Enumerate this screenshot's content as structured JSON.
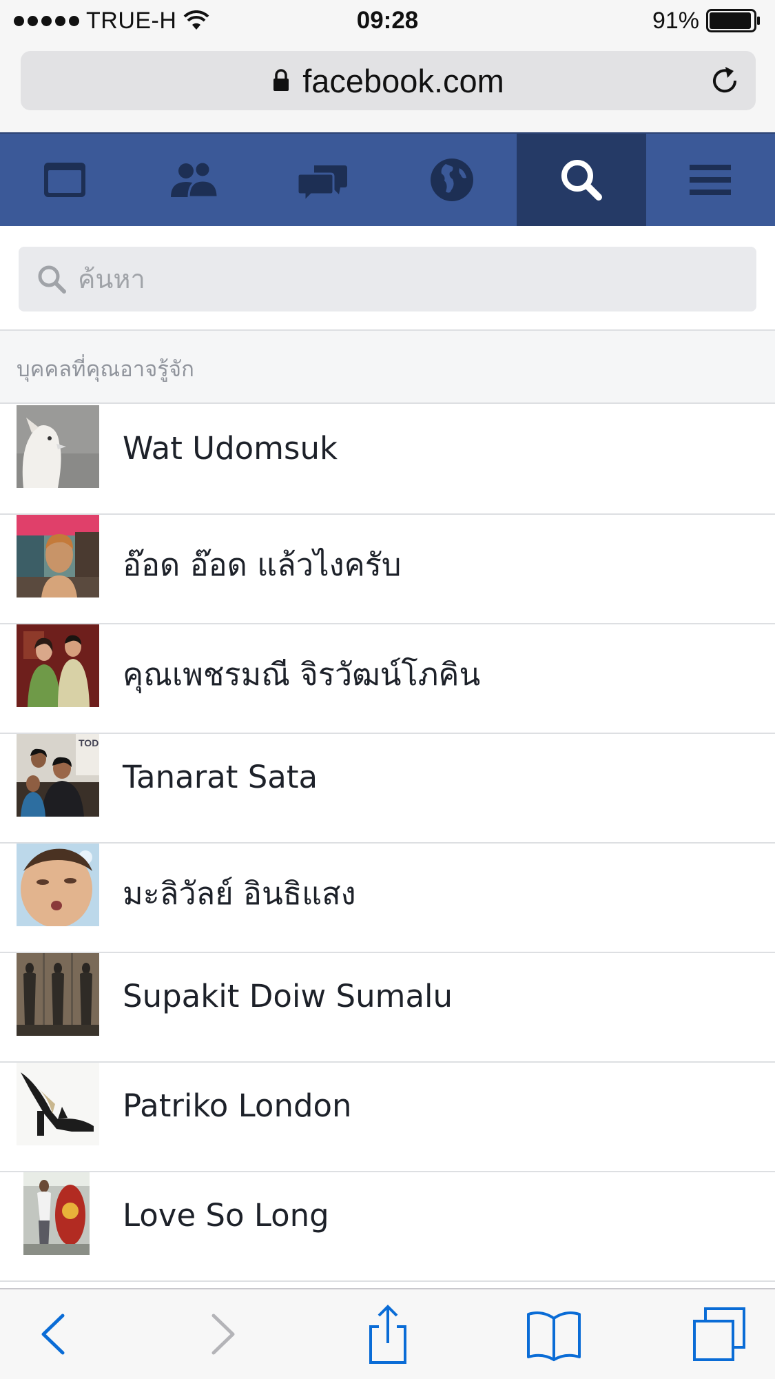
{
  "status_bar": {
    "carrier": "TRUE-H",
    "time": "09:28",
    "battery": "91%"
  },
  "browser": {
    "url": "facebook.com"
  },
  "nav": {
    "items": [
      {
        "icon": "news-feed-icon"
      },
      {
        "icon": "friends-icon"
      },
      {
        "icon": "messages-icon"
      },
      {
        "icon": "notifications-globe-icon"
      },
      {
        "icon": "search-icon",
        "active": true
      },
      {
        "icon": "menu-icon"
      }
    ]
  },
  "search": {
    "placeholder": "ค้นหา",
    "value": ""
  },
  "section": {
    "title": "บุคคลที่คุณอาจรู้จัก"
  },
  "people": [
    {
      "name": "Wat Udomsuk"
    },
    {
      "name": "อ๊อด อ๊อด แล้วไงครับ"
    },
    {
      "name": "คุณเพชรมณี จิรวัฒน์โภคิน"
    },
    {
      "name": "Tanarat Sata"
    },
    {
      "name": "มะลิวัลย์ อินธิแสง"
    },
    {
      "name": "Supakit Doiw Sumalu"
    },
    {
      "name": "Patriko London"
    },
    {
      "name": "Love So Long"
    }
  ],
  "colors": {
    "fb_blue": "#3b5998",
    "fb_blue_active": "#253a66",
    "ios_blue": "#0a6cd6"
  }
}
